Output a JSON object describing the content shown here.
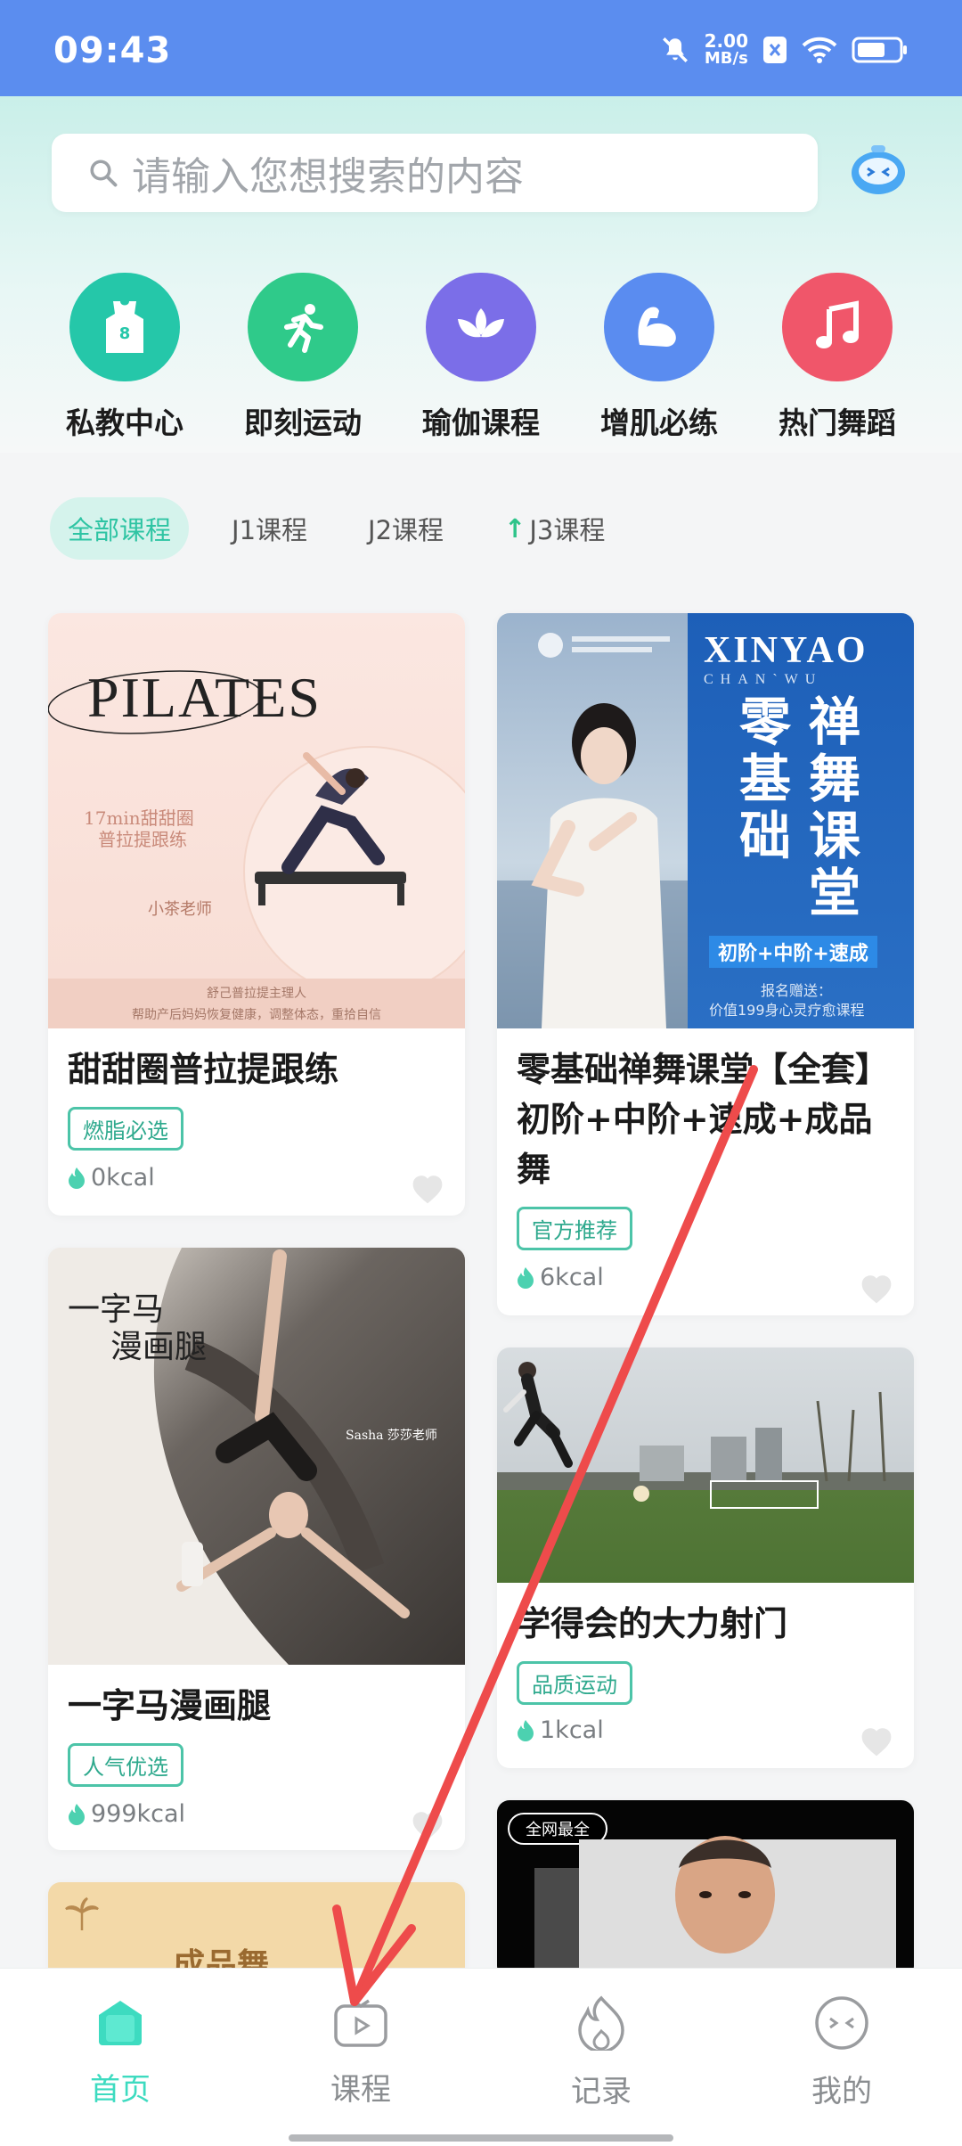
{
  "status_bar": {
    "time": "09:43",
    "speed_value": "2.00",
    "speed_unit": "MB/s"
  },
  "search": {
    "placeholder": "请输入您想搜索的内容"
  },
  "categories": [
    {
      "label": "私教中心",
      "color": "#25c7a9",
      "icon": "jersey-icon"
    },
    {
      "label": "即刻运动",
      "color": "#2fca8a",
      "icon": "running-icon"
    },
    {
      "label": "瑜伽课程",
      "color": "#7b6ee8",
      "icon": "lotus-icon"
    },
    {
      "label": "增肌必练",
      "color": "#5a8cf0",
      "icon": "muscle-icon"
    },
    {
      "label": "热门舞蹈",
      "color": "#f0566a",
      "icon": "music-note-icon"
    }
  ],
  "course_tabs": [
    {
      "label": "全部课程",
      "active": true
    },
    {
      "label": "J1课程"
    },
    {
      "label": "J2课程"
    },
    {
      "label": "J3课程",
      "prefix": "↑"
    }
  ],
  "courses": [
    {
      "title": "甜甜圈普拉提跟练",
      "tag": "燃脂必选",
      "kcal": "0kcal",
      "thumb": {
        "logo": "PILATES",
        "line1": "17min甜甜圈",
        "line2": "普拉提跟练",
        "teacher": "小茶老师",
        "foot1": "舒己普拉提主理人",
        "foot2": "帮助产后妈妈恢复健康，调整体态，重拾自信"
      }
    },
    {
      "title": "零基础禅舞课堂【全套】初阶+中阶+速成+成品舞",
      "tag": "官方推荐",
      "kcal": "6kcal",
      "thumb": {
        "brand": "XINYAO",
        "brand_sub": "CHAN`WU",
        "col1": "禅舞课堂",
        "col2": "零基础",
        "badge": "初阶+中阶+速成",
        "foot1": "报名赠送：",
        "foot2": "价值199身心灵疗愈课程"
      }
    },
    {
      "title": "学得会的大力射门",
      "tag": "品质运动",
      "kcal": "1kcal"
    },
    {
      "title": "一字马漫画腿",
      "tag": "人气优选",
      "kcal": "999kcal",
      "thumb": {
        "line1": "一字马",
        "line2": "漫画腿",
        "teacher": "Sasha 莎莎老师"
      }
    },
    {
      "thumb": {
        "text": "成品舞"
      }
    },
    {
      "thumb": {
        "label": "全网最全"
      }
    }
  ],
  "bottom_nav": [
    {
      "label": "首页",
      "active": true
    },
    {
      "label": "课程"
    },
    {
      "label": "记录"
    },
    {
      "label": "我的"
    }
  ],
  "colors": {
    "accent": "#3ddbc0",
    "status_bar": "#5b8def",
    "annotation_arrow": "#ee4b4b"
  }
}
